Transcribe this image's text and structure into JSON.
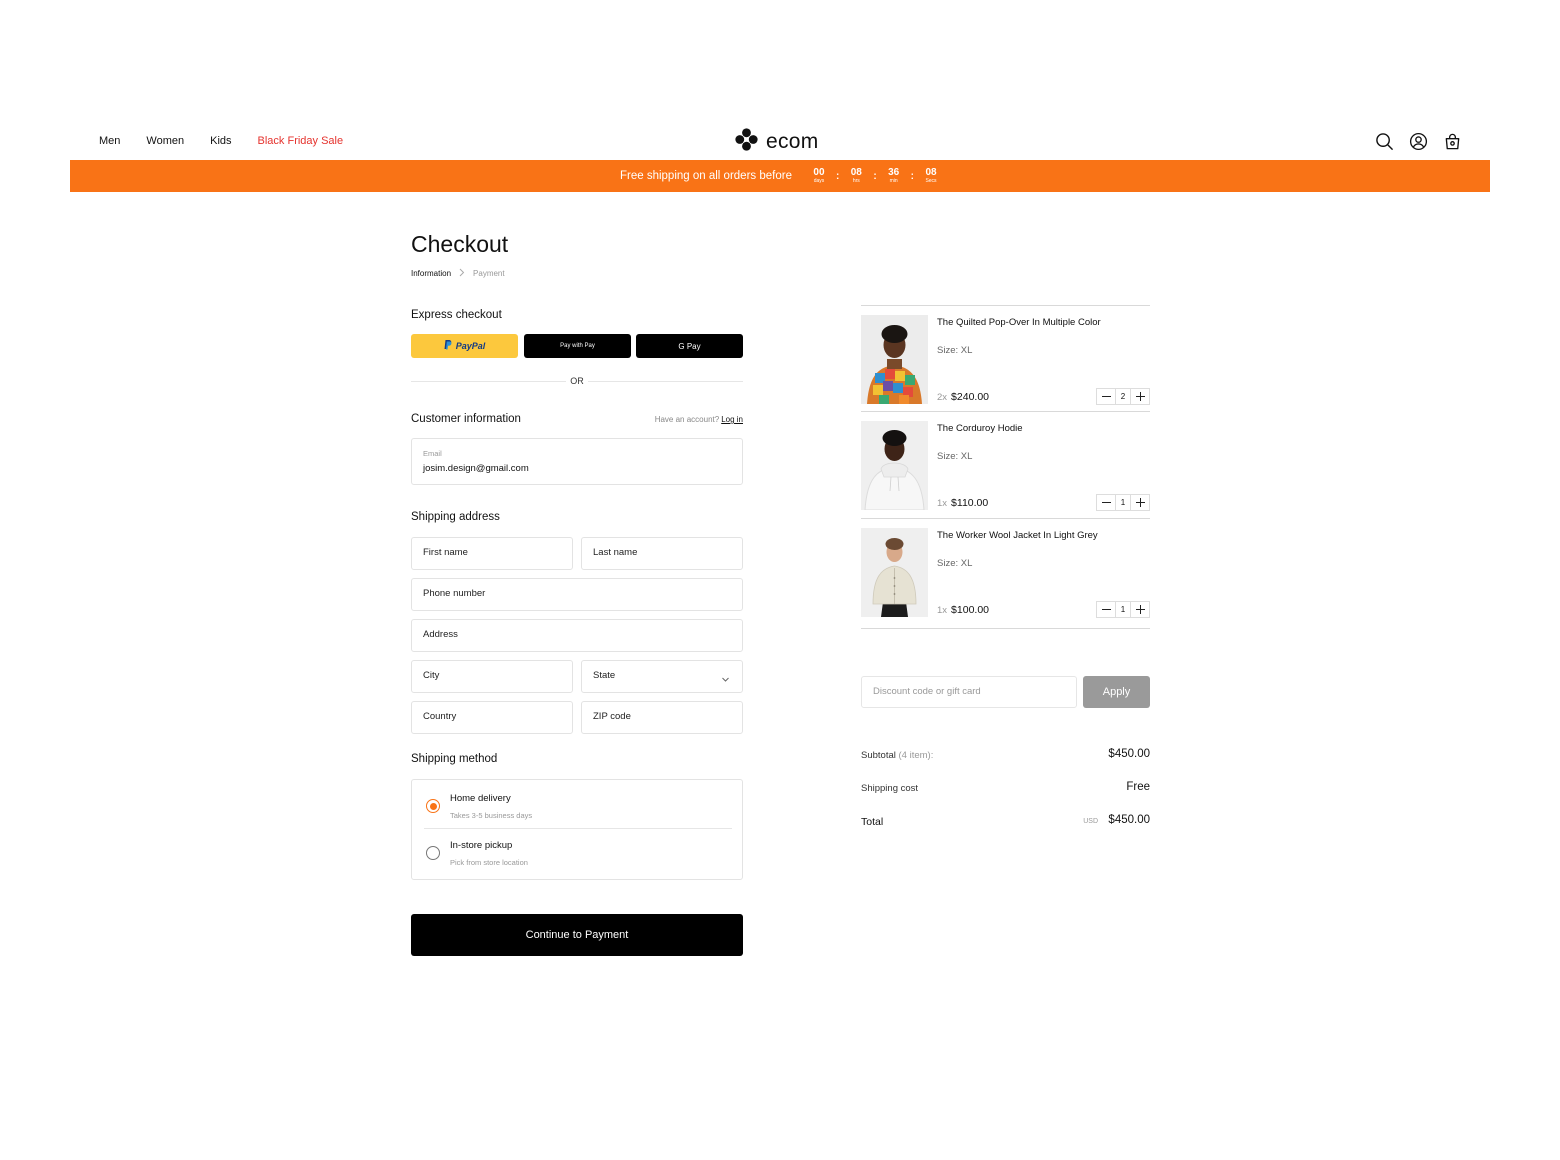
{
  "nav": {
    "items": [
      "Men",
      "Women",
      "Kids"
    ],
    "sale": "Black Friday Sale"
  },
  "brand": {
    "name": "ecom",
    "logo_icon": "flower-logo-icon"
  },
  "header_icons": [
    "search-icon",
    "user-icon",
    "bag-icon"
  ],
  "banner": {
    "message": "Free shipping on all orders before",
    "countdown": [
      {
        "value": "00",
        "unit": "days"
      },
      {
        "value": "08",
        "unit": "hrs"
      },
      {
        "value": "36",
        "unit": "min"
      },
      {
        "value": "08",
        "unit": "Secs"
      }
    ],
    "color": "#f97316"
  },
  "checkout": {
    "title": "Checkout",
    "breadcrumb": [
      "Information",
      "Payment"
    ],
    "express_label": "Express checkout",
    "express": {
      "paypal": "PayPal",
      "apple": "Pay with  Pay",
      "google": "G Pay"
    },
    "or": "OR",
    "customer_label": "Customer information",
    "have_account": "Have an account?",
    "login": "Log in",
    "email_label": "Email",
    "email_value": "josim.design@gmail.com",
    "shipping_label": "Shipping address",
    "fields": {
      "first_name": "First name",
      "last_name": "Last name",
      "phone": "Phone number",
      "address": "Address",
      "city": "City",
      "state": "State",
      "country": "Country",
      "zip": "ZIP code"
    },
    "method_label": "Shipping method",
    "methods": [
      {
        "name": "Home delivery",
        "sub": "Takes 3-5 business days",
        "selected": true
      },
      {
        "name": "In-store pickup",
        "sub": "Pick from store location",
        "selected": false
      }
    ],
    "continue": "Continue to Payment"
  },
  "cart": {
    "items": [
      {
        "name": "The Quilted Pop-Over In Multiple Color",
        "size": "Size: XL",
        "mult": "2x",
        "price": "$240.00",
        "qty": "2"
      },
      {
        "name": "The Corduroy Hodie",
        "size": "Size: XL",
        "mult": "1x",
        "price": "$110.00",
        "qty": "1"
      },
      {
        "name": "The Worker Wool Jacket In Light Grey",
        "size": "Size: XL",
        "mult": "1x",
        "price": "$100.00",
        "qty": "1"
      }
    ],
    "discount_placeholder": "Discount code or gift card",
    "apply": "Apply",
    "subtotal_label": "Subtotal",
    "subtotal_count": "(4 item):",
    "subtotal": "$450.00",
    "shipping_label": "Shipping cost",
    "shipping": "Free",
    "total_label": "Total",
    "currency": "USD",
    "total": "$450.00"
  }
}
